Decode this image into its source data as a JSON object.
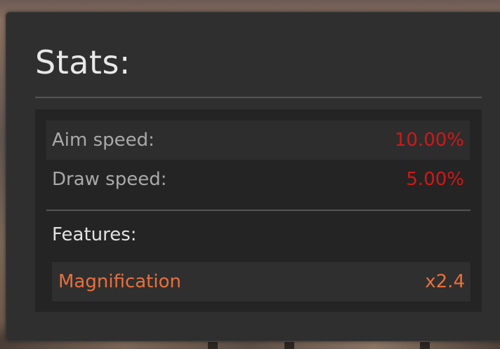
{
  "stats_panel": {
    "title": "Stats:",
    "stats": [
      {
        "label": "Aim speed:",
        "value": "10.00%"
      },
      {
        "label": "Draw speed:",
        "value": "5.00%"
      }
    ],
    "features_heading": "Features:",
    "features": [
      {
        "label": "Magnification",
        "value": "x2.4"
      }
    ]
  },
  "colors": {
    "panel_bg": "#2f2f2f",
    "inner_bg": "#242424",
    "stat_value": "#d01818",
    "feature_accent": "#e8703c"
  }
}
